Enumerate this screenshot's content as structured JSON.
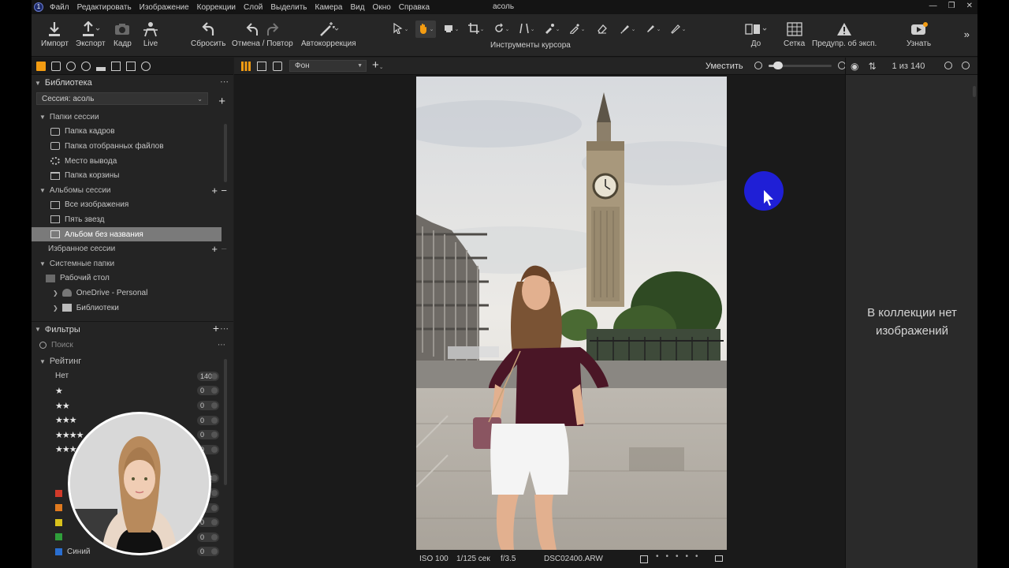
{
  "menu": {
    "items": [
      "Файл",
      "Редактировать",
      "Изображение",
      "Коррекции",
      "Слой",
      "Выделить",
      "Камера",
      "Вид",
      "Окно",
      "Справка"
    ],
    "window_title": "асоль"
  },
  "toolbar": {
    "import": "Импорт",
    "export": "Экспорт",
    "capture": "Кадр",
    "live": "Live",
    "reset": "Сбросить",
    "undo_redo": "Отмена / Повтор",
    "auto": "Автокоррекция",
    "cursor_tools": "Инструменты курсора",
    "before": "До",
    "grid": "Сетка",
    "exposure_warning": "Предупр. об эксп.",
    "learn": "Узнать"
  },
  "library": {
    "title": "Библиотека",
    "session_select": "Сессия: асоль",
    "session_folders": {
      "label": "Папки сессии",
      "items": [
        "Папка кадров",
        "Папка отобранных файлов",
        "Место вывода",
        "Папка корзины"
      ]
    },
    "session_albums": {
      "label": "Альбомы сессии",
      "items": [
        "Все изображения",
        "Пять звезд",
        "Альбом без названия"
      ],
      "selected_index": 2
    },
    "session_favorites": "Избранное сессии",
    "system_folders": {
      "label": "Системные папки",
      "items": [
        "Рабочий стол",
        "OneDrive - Personal",
        "Библиотеки"
      ]
    }
  },
  "filters": {
    "title": "Фильтры",
    "search_placeholder": "Поиск",
    "rating_label": "Рейтинг",
    "rating_rows": [
      {
        "label": "Нет",
        "count": "140"
      },
      {
        "label": "★",
        "count": "0"
      },
      {
        "label": "★★",
        "count": "0"
      },
      {
        "label": "★★★",
        "count": "0"
      },
      {
        "label": "★★★★",
        "count": "0"
      },
      {
        "label": "★★★★★",
        "count": "0"
      }
    ],
    "color_rows": [
      {
        "label": "",
        "count": "140",
        "color": ""
      },
      {
        "label": "",
        "count": "0",
        "color": "#d13a2a"
      },
      {
        "label": "",
        "count": "0",
        "color": "#e07a1f"
      },
      {
        "label": "",
        "count": "0",
        "color": "#d9c21c"
      },
      {
        "label": "",
        "count": "0",
        "color": "#2f9e3a"
      },
      {
        "label": "Синий",
        "count": "0",
        "color": "#2a6fd1"
      }
    ]
  },
  "viewer": {
    "background_select": "Фон",
    "fit_label": "Уместить",
    "zoom_level": 0.1
  },
  "status": {
    "iso": "ISO 100",
    "shutter": "1/125 сек",
    "aperture": "f/3.5",
    "filename": "DSC02400.ARW"
  },
  "browser": {
    "counter": "1 из 140",
    "empty_message_line1": "В коллекции нет",
    "empty_message_line2": "изображений"
  },
  "colors": {
    "accent": "#f39c12",
    "cursor_highlight": "#1f1fd6",
    "selection": "#7a7a7a"
  }
}
